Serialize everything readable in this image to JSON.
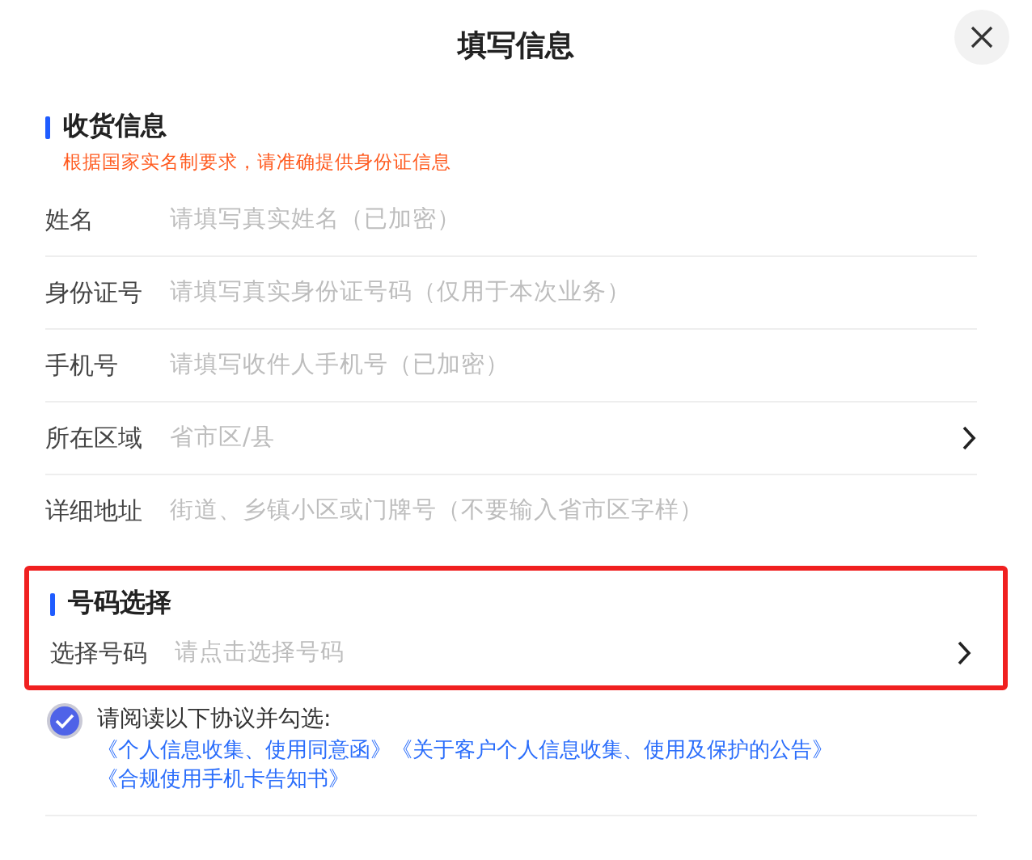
{
  "title": "填写信息",
  "shipping": {
    "heading": "收货信息",
    "notice": "根据国家实名制要求，请准确提供身份证信息",
    "fields": [
      {
        "label": "姓名",
        "placeholder": "请填写真实姓名（已加密）",
        "kind": "input"
      },
      {
        "label": "身份证号",
        "placeholder": "请填写真实身份证号码（仅用于本次业务）",
        "kind": "input"
      },
      {
        "label": "手机号",
        "placeholder": "请填写收件人手机号（已加密）",
        "kind": "input"
      },
      {
        "label": "所在区域",
        "placeholder": "省市区/县",
        "kind": "select"
      },
      {
        "label": "详细地址",
        "placeholder": "街道、乡镇小区或门牌号（不要输入省市区字样）",
        "kind": "input"
      }
    ]
  },
  "number_selection": {
    "heading": "号码选择",
    "highlighted": true,
    "field": {
      "label": "选择号码",
      "placeholder": "请点击选择号码",
      "kind": "select"
    }
  },
  "agreement": {
    "checked": true,
    "prompt": "请阅读以下协议并勾选:",
    "links": [
      "《个人信息收集、使用同意函》",
      "《关于客户个人信息收集、使用及保护的公告》",
      "《合规使用手机卡告知书》"
    ]
  }
}
